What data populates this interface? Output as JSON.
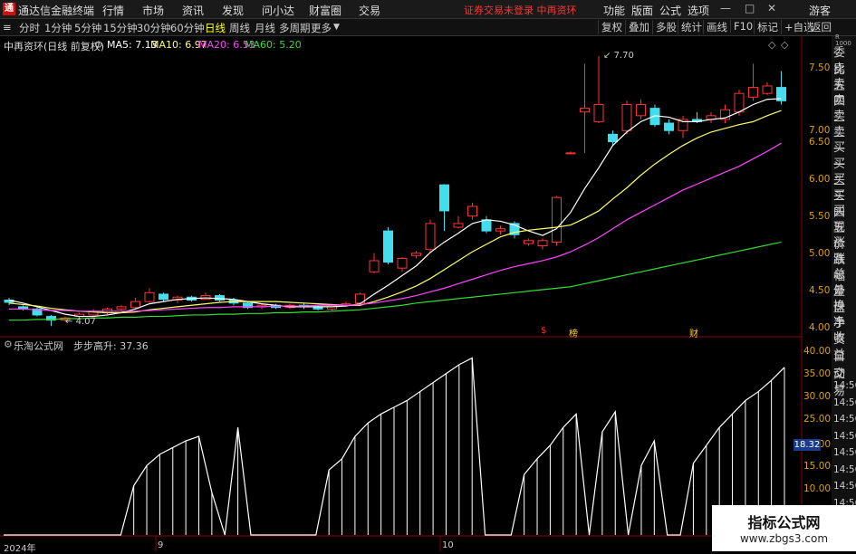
{
  "app": {
    "title": "通达信金融终端",
    "logo": "通",
    "notice": "证券交易未登录  中再资环",
    "guest": "游客"
  },
  "menu": [
    "行情",
    "市场",
    "资讯",
    "发现",
    "问小达",
    "财富圈",
    "交易"
  ],
  "top_tools": [
    "功能",
    "版面",
    "公式",
    "选项"
  ],
  "periods": [
    "分时",
    "1分钟",
    "5分钟",
    "15分钟",
    "30分钟",
    "60分钟",
    "日线",
    "周线",
    "月线",
    "多周期",
    "更多"
  ],
  "active_period": "日线",
  "right_tools": [
    "复权",
    "叠加",
    "多股",
    "统计",
    "画线",
    "F10",
    "标记",
    "+自选",
    "返回"
  ],
  "stock_label": "中再资环(日线 前复权)",
  "ma": [
    {
      "label": "MA5: 7.13",
      "color": "#ffffff"
    },
    {
      "label": "MA10: 6.97",
      "color": "#ffff66"
    },
    {
      "label": "MA20: 6.53",
      "color": "#ff44ff"
    },
    {
      "label": "MA60: 5.20",
      "color": "#33dd33"
    }
  ],
  "price_axis": [
    "7.50",
    "7.00",
    "6.50",
    "6.00",
    "5.50",
    "5.00",
    "4.50",
    "4.00"
  ],
  "max_label": "7.70",
  "min_label": "4.07",
  "right_panel": [
    "委比",
    "卖五",
    "卖四",
    "卖三",
    "卖二",
    "卖一",
    "买一",
    "买二",
    "买三",
    "买四",
    "买五",
    "现价",
    "涨跌",
    "涨幅",
    "总量",
    "外盘",
    "换手",
    "净资",
    "收益"
  ],
  "right_panel_bottom": [
    "自动",
    "交易",
    "14:56",
    "14:56",
    "14:56",
    "14:56",
    "14:56",
    "14:56",
    "14:56",
    "14:56"
  ],
  "markers": [
    "$",
    "榜",
    "财"
  ],
  "indicator": {
    "name": "乐淘公式网",
    "formula": "步步高升: 37.36",
    "axis": [
      "40.00",
      "35.00",
      "30.00",
      "25.00",
      "20.00",
      "15.00",
      "10.00"
    ],
    "current": "18.32"
  },
  "dates": [
    "2024年",
    "9",
    "10"
  ],
  "watermark": {
    "title": "指标公式网",
    "url": "www.zbgs3.com"
  },
  "chart_data": {
    "type": "candlestick",
    "price_range": [
      4.0,
      7.75
    ],
    "candles": [
      [
        4.42,
        4.39,
        4.45,
        4.35
      ],
      [
        4.33,
        4.3,
        4.35,
        4.28
      ],
      [
        4.3,
        4.22,
        4.32,
        4.2
      ],
      [
        4.2,
        4.15,
        4.22,
        4.07
      ],
      [
        4.15,
        4.18,
        4.2,
        4.13
      ],
      [
        4.2,
        4.23,
        4.25,
        4.18
      ],
      [
        4.22,
        4.27,
        4.3,
        4.2
      ],
      [
        4.25,
        4.3,
        4.32,
        4.23
      ],
      [
        4.3,
        4.33,
        4.35,
        4.28
      ],
      [
        4.32,
        4.4,
        4.45,
        4.3
      ],
      [
        4.4,
        4.52,
        4.58,
        4.38
      ],
      [
        4.5,
        4.43,
        4.52,
        4.4
      ],
      [
        4.42,
        4.46,
        4.48,
        4.38
      ],
      [
        4.46,
        4.42,
        4.48,
        4.4
      ],
      [
        4.43,
        4.48,
        4.52,
        4.42
      ],
      [
        4.48,
        4.42,
        4.5,
        4.4
      ],
      [
        4.42,
        4.38,
        4.45,
        4.35
      ],
      [
        4.38,
        4.32,
        4.4,
        4.3
      ],
      [
        4.33,
        4.35,
        4.37,
        4.3
      ],
      [
        4.35,
        4.32,
        4.37,
        4.3
      ],
      [
        4.32,
        4.35,
        4.37,
        4.3
      ],
      [
        4.35,
        4.33,
        4.38,
        4.3
      ],
      [
        4.33,
        4.3,
        4.35,
        4.28
      ],
      [
        4.3,
        4.35,
        4.37,
        4.28
      ],
      [
        4.35,
        4.37,
        4.4,
        4.33
      ],
      [
        4.38,
        4.5,
        4.52,
        4.36
      ],
      [
        4.8,
        4.95,
        5.05,
        4.78
      ],
      [
        5.35,
        4.93,
        5.4,
        4.9
      ],
      [
        4.85,
        4.98,
        5.0,
        4.8
      ],
      [
        5.02,
        5.05,
        5.08,
        4.98
      ],
      [
        5.1,
        5.45,
        5.5,
        5.05
      ],
      [
        5.97,
        5.62,
        5.98,
        5.35
      ],
      [
        5.4,
        5.45,
        5.55,
        5.38
      ],
      [
        5.55,
        5.68,
        5.73,
        5.5
      ],
      [
        5.5,
        5.35,
        5.55,
        5.32
      ],
      [
        5.35,
        5.38,
        5.42,
        5.3
      ],
      [
        5.45,
        5.3,
        5.48,
        5.25
      ],
      [
        5.18,
        5.22,
        5.25,
        5.15
      ],
      [
        5.15,
        5.22,
        5.25,
        5.1
      ],
      [
        5.2,
        5.8,
        5.82,
        5.15
      ],
      [
        6.4,
        6.4,
        6.42,
        6.38
      ],
      [
        6.95,
        7.0,
        7.6,
        6.4
      ],
      [
        6.82,
        7.05,
        7.7,
        6.8
      ],
      [
        6.65,
        6.55,
        6.7,
        6.5
      ],
      [
        6.7,
        7.05,
        7.1,
        6.65
      ],
      [
        6.9,
        7.05,
        7.12,
        6.85
      ],
      [
        7.0,
        6.78,
        7.05,
        6.75
      ],
      [
        6.8,
        6.7,
        6.85,
        6.65
      ],
      [
        6.7,
        6.85,
        6.9,
        6.6
      ],
      [
        6.85,
        6.82,
        6.95,
        6.8
      ],
      [
        6.85,
        6.9,
        6.95,
        6.8
      ],
      [
        6.85,
        6.98,
        7.05,
        6.8
      ],
      [
        6.95,
        7.2,
        7.25,
        6.9
      ],
      [
        7.15,
        7.28,
        7.6,
        7.1
      ],
      [
        7.2,
        7.3,
        7.35,
        7.18
      ],
      [
        7.28,
        7.1,
        7.5,
        7.05
      ]
    ],
    "ma_series": [
      {
        "name": "MA5",
        "values": [
          4.42,
          4.38,
          4.33,
          4.28,
          4.23,
          4.2,
          4.2,
          4.22,
          4.25,
          4.3,
          4.37,
          4.4,
          4.43,
          4.44,
          4.45,
          4.44,
          4.43,
          4.4,
          4.37,
          4.35,
          4.33,
          4.33,
          4.33,
          4.33,
          4.34,
          4.37,
          4.5,
          4.62,
          4.75,
          4.88,
          5.06,
          5.2,
          5.32,
          5.45,
          5.5,
          5.48,
          5.43,
          5.35,
          5.29,
          5.38,
          5.6,
          5.92,
          6.2,
          6.5,
          6.68,
          6.82,
          6.9,
          6.88,
          6.82,
          6.82,
          6.85,
          6.87,
          6.95,
          7.05,
          7.12,
          7.13
        ]
      },
      {
        "name": "MA10",
        "values": [
          4.38,
          4.36,
          4.34,
          4.31,
          4.29,
          4.27,
          4.26,
          4.25,
          4.25,
          4.26,
          4.29,
          4.31,
          4.33,
          4.35,
          4.37,
          4.39,
          4.4,
          4.4,
          4.4,
          4.4,
          4.39,
          4.38,
          4.37,
          4.36,
          4.35,
          4.35,
          4.4,
          4.46,
          4.53,
          4.61,
          4.71,
          4.83,
          4.95,
          5.07,
          5.17,
          5.27,
          5.33,
          5.36,
          5.38,
          5.4,
          5.43,
          5.52,
          5.62,
          5.78,
          5.93,
          6.1,
          6.25,
          6.38,
          6.5,
          6.6,
          6.68,
          6.73,
          6.78,
          6.82,
          6.9,
          6.97
        ]
      },
      {
        "name": "MA20",
        "values": [
          4.3,
          4.3,
          4.29,
          4.28,
          4.28,
          4.27,
          4.27,
          4.27,
          4.27,
          4.27,
          4.28,
          4.29,
          4.3,
          4.31,
          4.32,
          4.32,
          4.33,
          4.33,
          4.33,
          4.34,
          4.34,
          4.34,
          4.35,
          4.35,
          4.35,
          4.36,
          4.38,
          4.41,
          4.44,
          4.48,
          4.53,
          4.58,
          4.64,
          4.7,
          4.76,
          4.82,
          4.87,
          4.91,
          4.95,
          5.0,
          5.07,
          5.16,
          5.26,
          5.38,
          5.5,
          5.6,
          5.7,
          5.8,
          5.9,
          5.98,
          6.06,
          6.14,
          6.22,
          6.32,
          6.42,
          6.53
        ]
      },
      {
        "name": "MA60",
        "values": [
          4.15,
          4.15,
          4.16,
          4.16,
          4.17,
          4.17,
          4.18,
          4.18,
          4.19,
          4.19,
          4.2,
          4.2,
          4.21,
          4.22,
          4.22,
          4.23,
          4.23,
          4.24,
          4.24,
          4.25,
          4.25,
          4.26,
          4.26,
          4.27,
          4.28,
          4.29,
          4.31,
          4.33,
          4.35,
          4.38,
          4.4,
          4.42,
          4.44,
          4.46,
          4.48,
          4.5,
          4.52,
          4.54,
          4.56,
          4.58,
          4.6,
          4.64,
          4.68,
          4.72,
          4.76,
          4.8,
          4.84,
          4.88,
          4.92,
          4.96,
          5.0,
          5.04,
          5.08,
          5.12,
          5.16,
          5.2
        ]
      }
    ],
    "indicator_series": {
      "name": "步步高升",
      "range": [
        0,
        41
      ],
      "values": [
        0,
        0,
        0,
        0,
        0,
        0,
        0,
        0,
        0,
        0,
        11,
        15.5,
        18,
        19.5,
        21,
        22,
        9.5,
        0,
        24,
        0,
        0,
        0,
        0,
        0,
        0,
        14.5,
        17,
        22,
        25,
        27,
        28.5,
        30,
        32,
        34,
        36,
        38,
        39.5,
        0,
        0,
        0,
        13.5,
        17,
        20,
        24,
        27,
        0,
        23,
        27.5,
        0,
        15.5,
        21,
        0,
        0,
        16,
        20,
        24,
        27,
        30,
        32,
        34.5,
        37.4
      ]
    }
  }
}
